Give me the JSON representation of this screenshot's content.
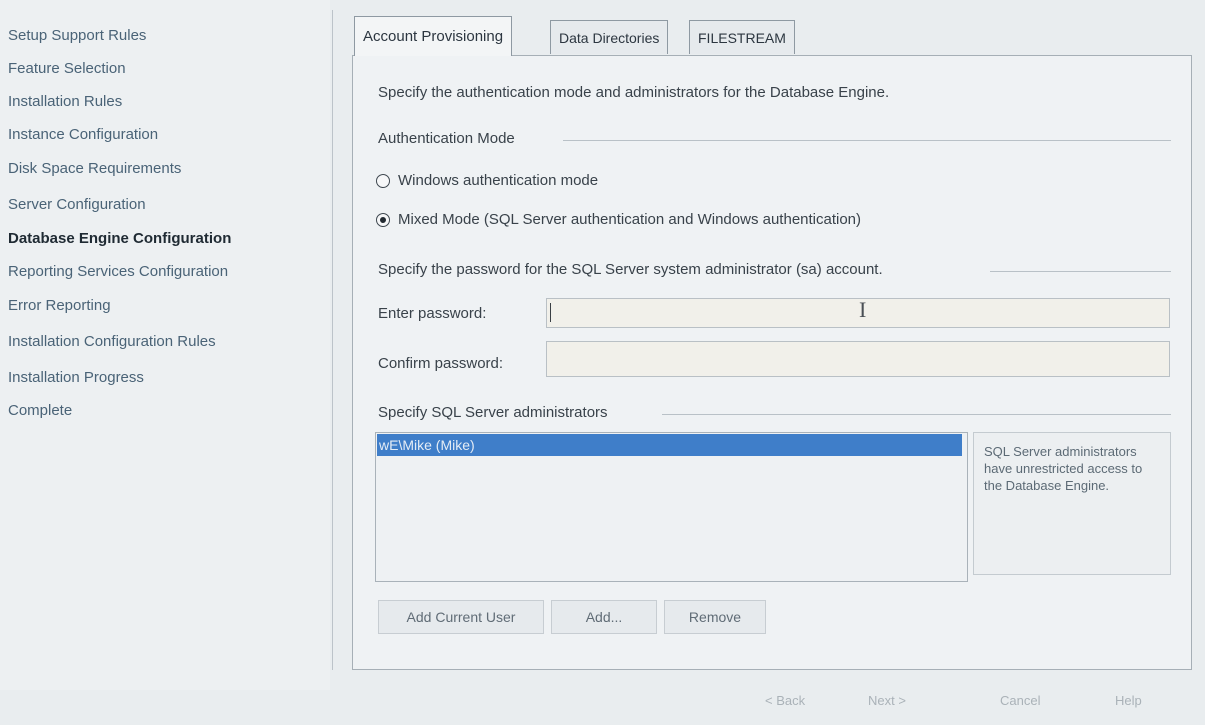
{
  "sidebar": {
    "items": [
      {
        "label": "Setup Support Rules",
        "active": false
      },
      {
        "label": "Feature Selection",
        "active": false
      },
      {
        "label": "Installation Rules",
        "active": false
      },
      {
        "label": "Instance Configuration",
        "active": false
      },
      {
        "label": "Disk Space Requirements",
        "active": false
      },
      {
        "label": "Server Configuration",
        "active": false
      },
      {
        "label": "Database Engine Configuration",
        "active": true
      },
      {
        "label": "Reporting Services Configuration",
        "active": false
      },
      {
        "label": "Error Reporting",
        "active": false
      },
      {
        "label": "Installation Configuration Rules",
        "active": false
      },
      {
        "label": "Installation Progress",
        "active": false
      },
      {
        "label": "Complete",
        "active": false
      }
    ]
  },
  "tabs": [
    {
      "label": "Account Provisioning",
      "active": true
    },
    {
      "label": "Data Directories",
      "active": false
    },
    {
      "label": "FILESTREAM",
      "active": false
    }
  ],
  "panel": {
    "description": "Specify the authentication mode and administrators for the Database Engine.",
    "auth_group_label": "Authentication Mode",
    "radio_windows": "Windows authentication mode",
    "radio_mixed": "Mixed Mode (SQL Server authentication and Windows authentication)",
    "selected_mode": "mixed",
    "password_group_label": "Specify the password for the SQL Server system administrator (sa) account.",
    "enter_password_label": "Enter password:",
    "enter_password_value": "",
    "confirm_password_label": "Confirm password:",
    "confirm_password_value": "",
    "admins_group_label": "Specify SQL Server administrators",
    "admins": [
      "wE\\Mike (Mike)"
    ],
    "admins_info": "SQL Server administrators have unrestricted access to the Database Engine.",
    "add_current_user": "Add Current User",
    "add": "Add...",
    "remove": "Remove"
  },
  "footer": {
    "back": "< Back",
    "next": "Next >",
    "cancel": "Cancel",
    "help": "Help"
  }
}
